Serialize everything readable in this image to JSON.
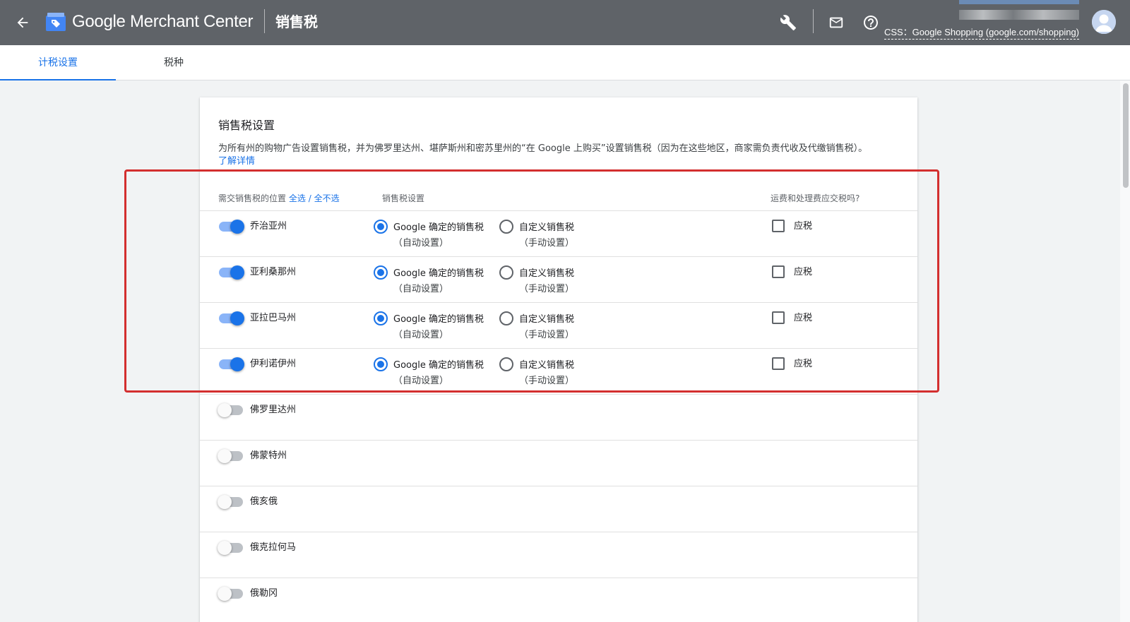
{
  "header": {
    "product_name": "Google Merchant Center",
    "page_title": "销售税",
    "css_label": "CSS：Google Shopping (google.com/shopping)",
    "icons": [
      "back-arrow-icon",
      "wrench-icon",
      "mail-icon",
      "help-icon",
      "account-avatar-icon"
    ]
  },
  "tabs": [
    {
      "label": "计税设置",
      "active": true
    },
    {
      "label": "税种",
      "active": false
    }
  ],
  "card": {
    "title": "销售税设置",
    "description": "为所有州的购物广告设置销售税，并为佛罗里达州、堪萨斯州和密苏里州的“在 Google 上购买”设置销售税（因为在这些地区，商家需负责代收及代缴销售税）。",
    "learn_more": "了解详情",
    "columns": {
      "location": "需交销售税的位置",
      "select_all": "全选",
      "separator": "/",
      "select_none": "全不选",
      "tax_setting": "销售税设置",
      "shipping_taxable": "运费和处理费应交税吗?"
    },
    "options": {
      "google_line1": "Google 确定的销售税",
      "google_line2": "（自动设置）",
      "custom_line1": "自定义销售税",
      "custom_line2": "（手动设置）",
      "taxable": "应税"
    },
    "states": [
      {
        "name": "乔治亚州",
        "enabled": true,
        "rate": "google",
        "taxable": false
      },
      {
        "name": "亚利桑那州",
        "enabled": true,
        "rate": "google",
        "taxable": false
      },
      {
        "name": "亚拉巴马州",
        "enabled": true,
        "rate": "google",
        "taxable": false
      },
      {
        "name": "伊利诺伊州",
        "enabled": true,
        "rate": "google",
        "taxable": false
      },
      {
        "name": "佛罗里达州",
        "enabled": false
      },
      {
        "name": "佛蒙特州",
        "enabled": false
      },
      {
        "name": "俄亥俄",
        "enabled": false
      },
      {
        "name": "俄克拉何马",
        "enabled": false
      },
      {
        "name": "俄勒冈",
        "enabled": false
      }
    ]
  },
  "colors": {
    "topbar": "#5f6368",
    "accent": "#1a73e8",
    "highlight": "#d32f2f"
  }
}
